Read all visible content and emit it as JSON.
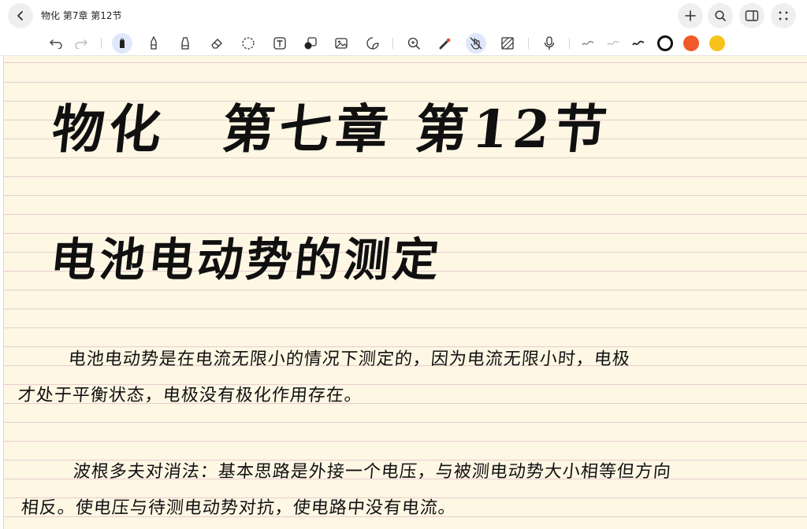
{
  "window": {
    "title": "物化 第7章 第12节"
  },
  "topbar": {
    "back_icon": "chevron-left-icon",
    "right_icons": [
      "plus-icon",
      "search-icon",
      "sidebar-icon",
      "more-dots-icon"
    ]
  },
  "toolbar": {
    "tools": [
      "undo-icon",
      "redo-icon",
      "pen-icon",
      "pencil-icon",
      "highlighter-icon",
      "eraser-icon",
      "lasso-icon",
      "text-icon",
      "shapes-icon",
      "image-icon",
      "sticker-icon",
      "zoom-icon",
      "laser-pointer-icon",
      "hand-touch-icon",
      "pattern-icon",
      "microphone-icon"
    ],
    "active_tool": "pen-icon",
    "colors": {
      "black": "#111111",
      "red": "#f05a28",
      "yellow": "#f7c31a"
    },
    "selected_color": "#111111"
  },
  "note": {
    "heading_line1": "物化　第七章 第12节",
    "heading_line2": "电池电动势的测定",
    "paragraph1_line1": "电池电动势是在电流无限小的情况下测定的，因为电流无限小时，电极",
    "paragraph1_line2": "才处于平衡状态，电极没有极化作用存在。",
    "paragraph2_line1": "波根多夫对消法：基本思路是外接一个电压，与被测电动势大小相等但方向",
    "paragraph2_line2": "相反。使电压与待测电动势对抗，使电路中没有电流。"
  }
}
